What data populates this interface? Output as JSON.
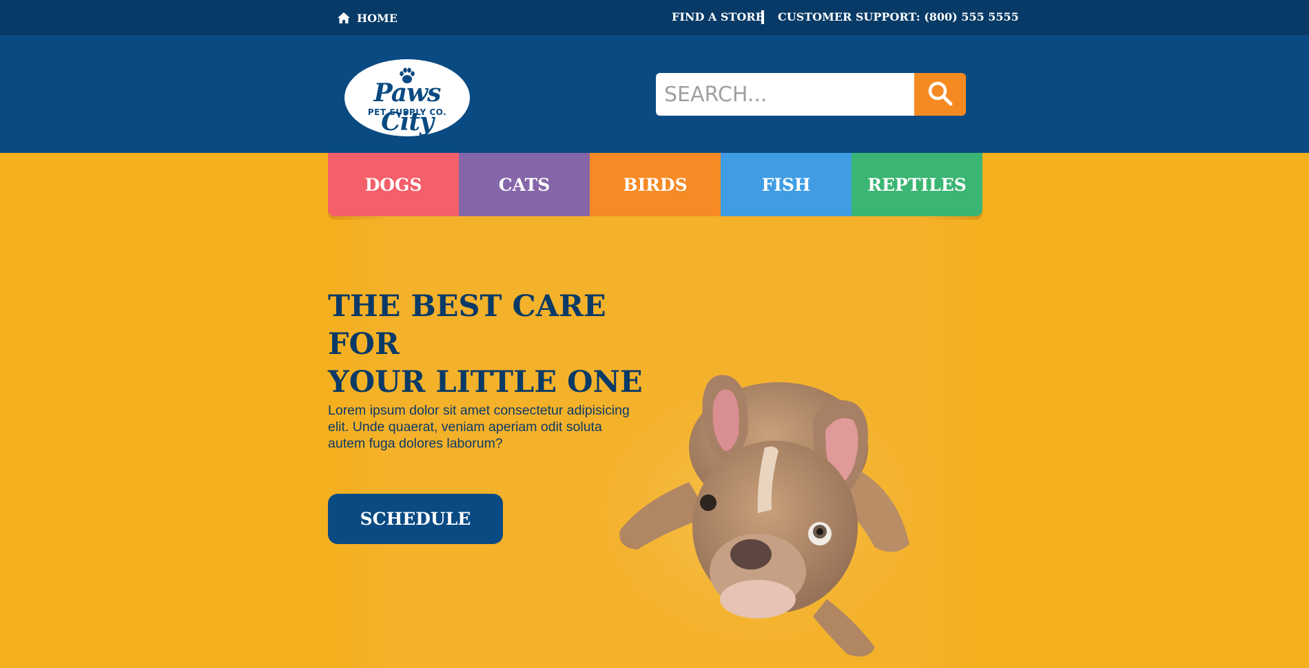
{
  "topbar": {
    "home_label": "HOME",
    "find_store_label": "FIND A STORE",
    "support_label": "CUSTOMER SUPPORT: (800) 555 5555"
  },
  "header": {
    "logo_name": "Paws City",
    "logo_sub": "PET SUPPLY CO.",
    "search_placeholder": "SEARCH..."
  },
  "nav": {
    "items": [
      {
        "label": "DOGS",
        "color": "#f45f6a"
      },
      {
        "label": "CATS",
        "color": "#8566a8"
      },
      {
        "label": "BIRDS",
        "color": "#f68a25"
      },
      {
        "label": "FISH",
        "color": "#409de4"
      },
      {
        "label": "REPTILES",
        "color": "#3bb573"
      }
    ]
  },
  "hero": {
    "title_line1": "THE BEST CARE FOR",
    "title_line2": "YOUR LITTLE ONE",
    "body": "Lorem ipsum dolor sit amet consectetur adipisicing elit. Unde quaerat, veniam aperiam odit soluta autem fuga dolores laborum?",
    "button_label": "SCHEDULE"
  },
  "colors": {
    "topbar": "#073a66",
    "header": "#0a4a82",
    "background": "#f5b01e",
    "accent": "#f58a22"
  },
  "icons": [
    "home-icon",
    "search-icon",
    "paw-icon"
  ]
}
